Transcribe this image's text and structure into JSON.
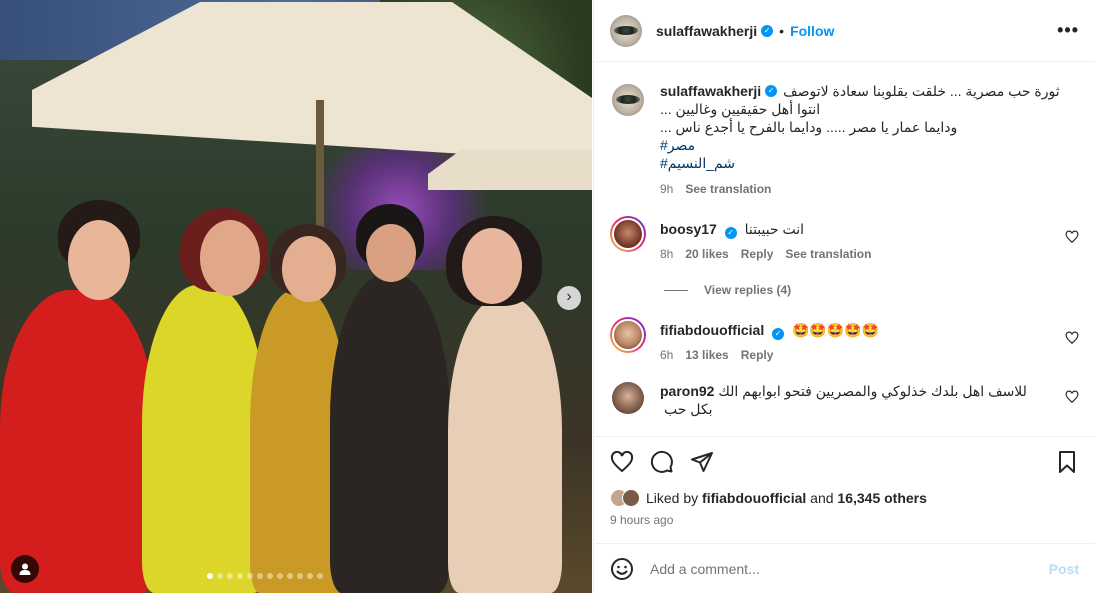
{
  "post": {
    "author": "sulaffawakherji",
    "follow_label": "Follow",
    "separator": "•",
    "more_label": "•••",
    "carousel": {
      "slide_count": 12,
      "active_index": 0,
      "next_glyph": "›"
    },
    "caption": {
      "lines": [
        "ثورة حب مصرية ... خلقت بقلوبنا سعادة لاتوصف",
        "انتوا أهل حقيقيين وغاليين ...",
        "ودايما عمار يا مصر ..... ودايما بالفرح يا أجدع ناس ..."
      ],
      "hashtags": [
        "#مصر",
        "#شم_النسيم"
      ],
      "time": "9h",
      "see_translation": "See translation"
    }
  },
  "comments": [
    {
      "user": "boosy17",
      "verified": true,
      "text": "انت حبيبتنا",
      "time": "8h",
      "likes": "20 likes",
      "reply": "Reply",
      "see_translation": "See translation",
      "view_replies": "View replies (4)"
    },
    {
      "user": "fifiabdouofficial",
      "verified": true,
      "text": "🤩🤩🤩🤩🤩",
      "time": "6h",
      "likes": "13 likes",
      "reply": "Reply"
    },
    {
      "user": "paron92",
      "verified": false,
      "text": "للاسف اهل بلدك خذلوكي والمصريين فتحو ابوابهم الك بكل حب"
    }
  ],
  "actions": {
    "icons": [
      "heart-icon",
      "comment-icon",
      "share-icon",
      "bookmark-icon"
    ]
  },
  "likes": {
    "liked_by_prefix": "Liked by",
    "liked_by_user": "fifiabdouofficial",
    "and": "and",
    "others": "16,345 others",
    "time_ago": "9 hours ago"
  },
  "comment_box": {
    "placeholder": "Add a comment...",
    "post_label": "Post"
  },
  "colors": {
    "accent": "#0095f6",
    "hashtag": "#00376b",
    "muted": "#737373",
    "post_disabled": "#b2dffc"
  }
}
